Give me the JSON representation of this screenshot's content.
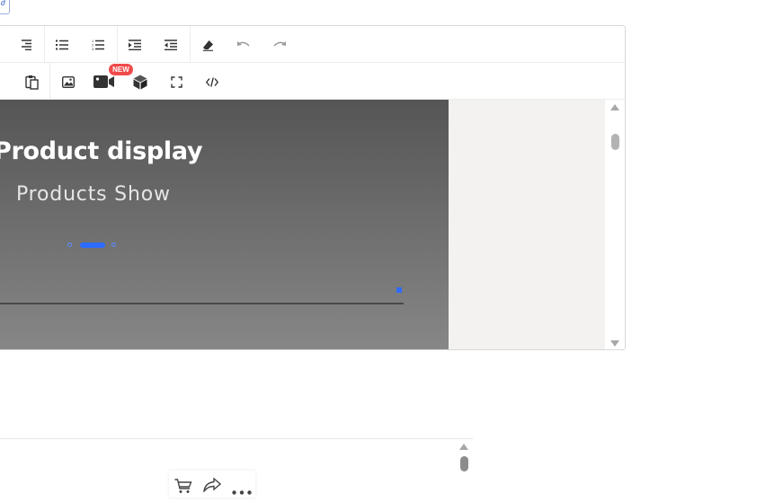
{
  "toolbar": {
    "row1": [
      {
        "icon": "align-right-icon",
        "label": "Align right"
      },
      {
        "icon": "bullet-list-icon",
        "label": "Bulleted list"
      },
      {
        "icon": "numbered-list-icon",
        "label": "Numbered list"
      },
      {
        "icon": "indent-increase-icon",
        "label": "Increase indent"
      },
      {
        "icon": "indent-decrease-icon",
        "label": "Decrease indent"
      },
      {
        "icon": "eraser-icon",
        "label": "Clear formatting"
      },
      {
        "icon": "undo-icon",
        "label": "Undo"
      },
      {
        "icon": "redo-icon",
        "label": "Redo"
      }
    ],
    "row2": [
      {
        "icon": "paste-icon"
      },
      {
        "icon": "image-icon"
      },
      {
        "icon": "video-icon"
      },
      {
        "icon": "cube-icon"
      },
      {
        "icon": "fullscreen-icon"
      },
      {
        "icon": "code-icon"
      }
    ],
    "new_badge": "NEW"
  },
  "banner": {
    "title": "Product display",
    "subtitle": "Products Show"
  },
  "colors": {
    "accent": "#2e6bff",
    "badge": "#f04b4b"
  }
}
